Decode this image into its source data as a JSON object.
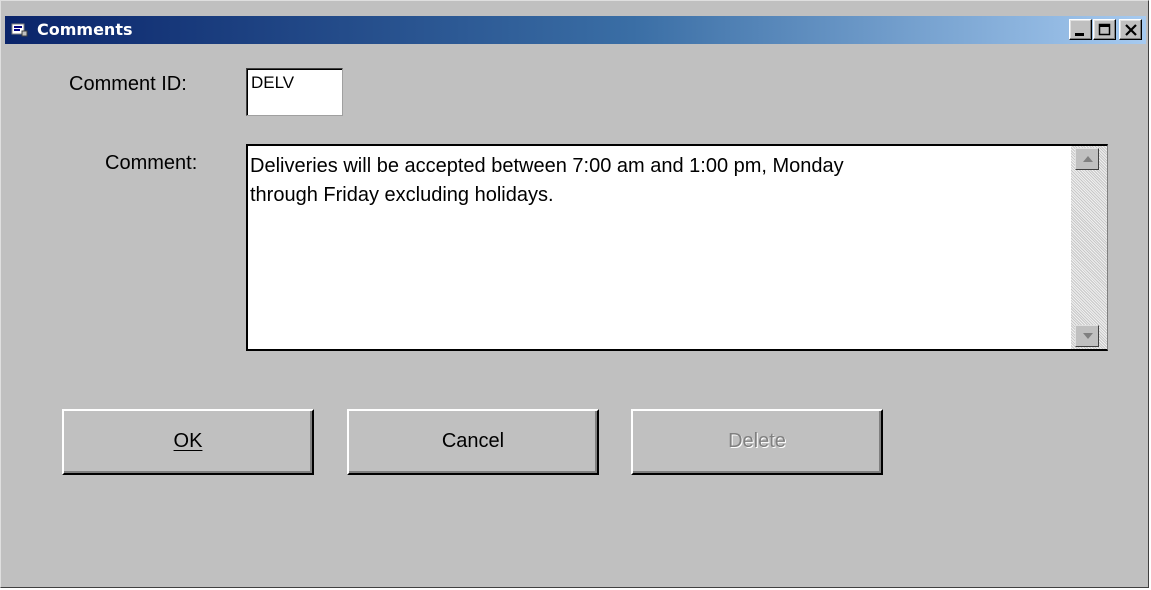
{
  "window": {
    "title": "Comments",
    "icon": "app-icon",
    "caption_buttons": [
      "minimize-icon",
      "maximize-icon",
      "close-icon"
    ]
  },
  "form": {
    "comment_id_label": "Comment ID:",
    "comment_id_value": "DELV",
    "comment_label": "Comment:",
    "comment_line1": "Deliveries will be accepted between 7:00 am and 1:00 pm, Monday",
    "comment_line2": "through Friday excluding holidays."
  },
  "buttons": {
    "ok": "OK",
    "cancel": "Cancel",
    "delete": "Delete",
    "delete_disabled": true
  }
}
